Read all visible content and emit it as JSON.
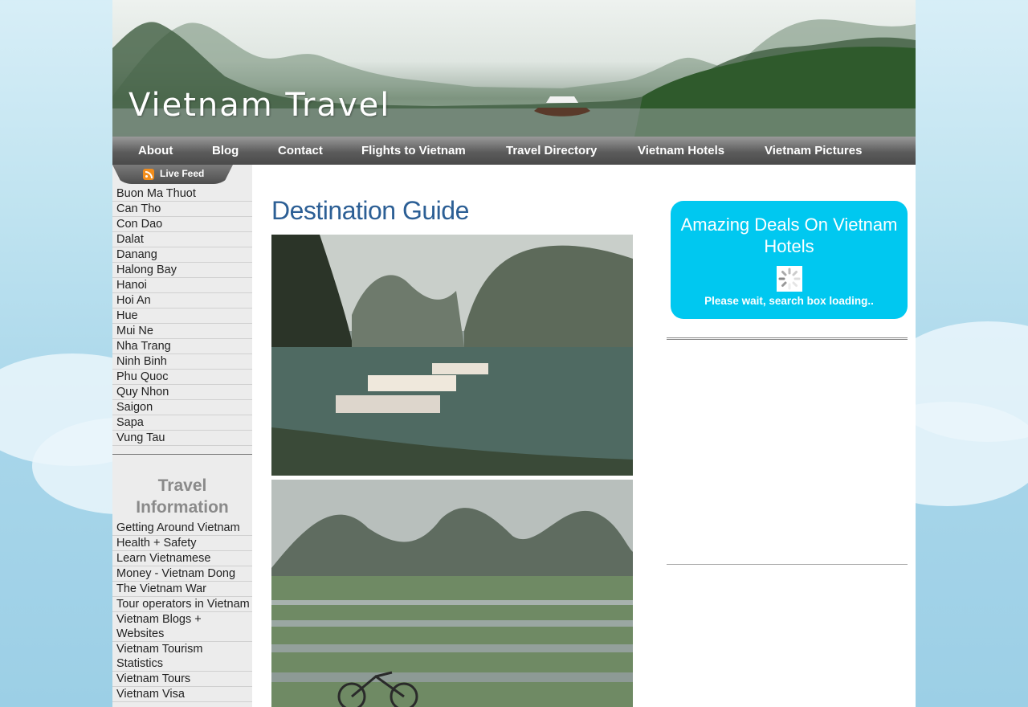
{
  "header": {
    "site_title": "Vietnam Travel"
  },
  "nav": [
    {
      "label": "About"
    },
    {
      "label": "Blog"
    },
    {
      "label": "Contact"
    },
    {
      "label": "Flights to Vietnam"
    },
    {
      "label": "Travel Directory"
    },
    {
      "label": "Vietnam Hotels"
    },
    {
      "label": "Vietnam Pictures"
    }
  ],
  "live_feed": {
    "label": "Live Feed",
    "icon": "rss-icon"
  },
  "sidebar": {
    "destinations": [
      {
        "label": "Buon Ma Thuot"
      },
      {
        "label": "Can Tho"
      },
      {
        "label": "Con Dao"
      },
      {
        "label": "Dalat"
      },
      {
        "label": "Danang"
      },
      {
        "label": "Halong Bay"
      },
      {
        "label": "Hanoi"
      },
      {
        "label": "Hoi An"
      },
      {
        "label": "Hue"
      },
      {
        "label": "Mui Ne"
      },
      {
        "label": "Nha Trang"
      },
      {
        "label": "Ninh Binh"
      },
      {
        "label": "Phu Quoc"
      },
      {
        "label": "Quy Nhon"
      },
      {
        "label": "Saigon"
      },
      {
        "label": "Sapa"
      },
      {
        "label": "Vung Tau"
      }
    ],
    "travel_info_heading": "Travel Information",
    "travel_info": [
      {
        "label": "Getting Around Vietnam"
      },
      {
        "label": "Health + Safety"
      },
      {
        "label": "Learn Vietnamese"
      },
      {
        "label": "Money - Vietnam Dong"
      },
      {
        "label": "The Vietnam War"
      },
      {
        "label": "Tour operators in Vietnam"
      },
      {
        "label": "Vietnam Blogs + Websites"
      },
      {
        "label": "Vietnam Tourism Statistics"
      },
      {
        "label": "Vietnam Tours"
      },
      {
        "label": "Vietnam Visa"
      }
    ]
  },
  "main": {
    "title": "Destination Guide"
  },
  "deals_widget": {
    "title": "Amazing Deals On Vietnam Hotels",
    "loading_text": "Please wait, search box loading.."
  },
  "colors": {
    "title_blue": "#2c5f95",
    "widget_cyan": "#00c8f0",
    "nav_gray": "#5c5c5c"
  }
}
